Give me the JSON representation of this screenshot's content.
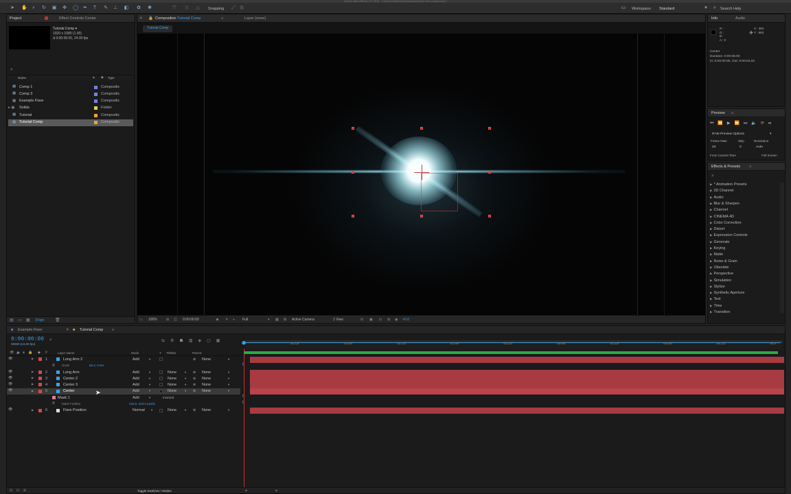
{
  "window": {
    "title": "Adobe After Effects CC 2014 - /Users/Caleb/ward/Downloads/lens flare project.aep *"
  },
  "toolbar": {
    "snapping": "Snapping",
    "workspace_label": "Workspace:",
    "workspace_value": "Standard",
    "search_help": "Search Help"
  },
  "project_panel": {
    "tabs": [
      "Project",
      "Effect Controls Center"
    ],
    "comp_name": "Tutorial Comp ▾",
    "comp_info": [
      "1920 x 1080 (1.00)",
      "Δ 0:00:05:00, 24.00 fps"
    ],
    "columns": {
      "name": "Name",
      "type": "Type"
    },
    "items": [
      {
        "name": "Comp 1",
        "type": "Compositic",
        "color": "#7a7fe0",
        "selected": false
      },
      {
        "name": "Comp 3",
        "type": "Compositic",
        "color": "#7a7fe0",
        "selected": false
      },
      {
        "name": "Example Flare",
        "type": "Compositic",
        "color": "#7a7fe0",
        "selected": false
      },
      {
        "name": "Solids",
        "type": "Folder",
        "color": "#e8d04a",
        "selected": false
      },
      {
        "name": "Tutorial",
        "type": "Compositic",
        "color": "#e8a04a",
        "selected": false
      },
      {
        "name": "Tutorial Comp",
        "type": "Compositic",
        "color": "#e8a04a",
        "selected": true
      }
    ],
    "bpc": "8 bpc"
  },
  "composition_panel": {
    "tab_prefix": "Composition",
    "tab_name": "Tutorial Comp",
    "layer_tab": "Layer (none)",
    "breadcrumb": "Tutorial Comp",
    "footer": {
      "zoom": "100%",
      "timecode": "0:00:00:00",
      "resolution": "Full",
      "camera": "Active Camera",
      "view": "1 View",
      "exposure": "+0.0"
    }
  },
  "info_panel": {
    "tabs": [
      "Info",
      "Audio"
    ],
    "channels": [
      "R :",
      "G :",
      "B :",
      "A : 0"
    ],
    "x": "X : 384",
    "y": "Y : 883",
    "layer_name": "Center",
    "duration": "Duration: 0:00:05:00",
    "in_out": "In: 0:00:00:00, Out: 0:00:04:23"
  },
  "preview_panel": {
    "title": "Preview",
    "ram_options": "RAM Preview Options",
    "labels": {
      "frame_rate": "Frame Rate",
      "skip": "Skip",
      "resolution": "Resolution"
    },
    "values": {
      "frame_rate": "24",
      "skip": "0",
      "resolution": "Auto"
    },
    "from_current": "From Current Time",
    "full_screen": "Full Screen"
  },
  "effects_panel": {
    "title": "Effects & Presets",
    "items": [
      "* Animation Presets",
      "3D Channel",
      "Audio",
      "Blur & Sharpen",
      "Channel",
      "CINEMA 4D",
      "Color Correction",
      "Distort",
      "Expression Controls",
      "Generate",
      "Keying",
      "Matte",
      "Noise & Grain",
      "Obsolete",
      "Perspective",
      "Simulation",
      "Stylize",
      "Synthetic Aperture",
      "Text",
      "Time",
      "Transition"
    ]
  },
  "timeline": {
    "tabs": [
      "Example Flare",
      "Tutorial Comp"
    ],
    "timecode": "0:00:00:00",
    "fps": "00000 (24.00 fps)",
    "columns": {
      "layer_name": "Layer Name",
      "mode": "Mode",
      "t": "T",
      "trkmat": "TrkMat",
      "parent": "Parent"
    },
    "ruler": [
      "00:12f",
      "01:00f",
      "01:12f",
      "02:00f",
      "02:12f",
      "03:00f",
      "03:12f",
      "04:00f",
      "04:12f",
      "05:0"
    ],
    "layers": [
      {
        "num": "1",
        "name": "Long Arm 2",
        "mode": "Add",
        "trkmat": "",
        "parent": "None",
        "label": "#d44a4a",
        "type": "sub"
      },
      {
        "num": "",
        "name": "Scale",
        "mode": "",
        "trkmat": "",
        "parent": "",
        "label": "",
        "type": "prop",
        "value": "65.2, 5.9%"
      },
      {
        "num": "2",
        "name": "Long Arm",
        "mode": "Add",
        "trkmat": "None",
        "parent": "None",
        "label": "#d44a4a",
        "type": "layer"
      },
      {
        "num": "3",
        "name": "Center 2",
        "mode": "Add",
        "trkmat": "None",
        "parent": "None",
        "label": "#d44a4a",
        "type": "layer"
      },
      {
        "num": "4",
        "name": "Center 3",
        "mode": "Add",
        "trkmat": "None",
        "parent": "None",
        "label": "#d44a4a",
        "type": "layer"
      },
      {
        "num": "5",
        "name": "Center",
        "mode": "Add",
        "trkmat": "None",
        "parent": "None",
        "label": "#d44a4a",
        "type": "layer",
        "selected": true
      },
      {
        "num": "",
        "name": "Mask 1",
        "mode": "Add",
        "trkmat": "Inverted",
        "parent": "",
        "label": "#e07a9a",
        "type": "mask"
      },
      {
        "num": "",
        "name": "Mask Feather",
        "mode": "",
        "trkmat": "",
        "parent": "",
        "label": "",
        "type": "prop",
        "value": "223.0, 223.0 pixels"
      },
      {
        "num": "6",
        "name": "Flare Position",
        "mode": "Normal",
        "trkmat": "None",
        "parent": "None",
        "label": "#d44a4a",
        "type": "layer"
      }
    ],
    "footer": "Toggle Switches / Modes"
  }
}
